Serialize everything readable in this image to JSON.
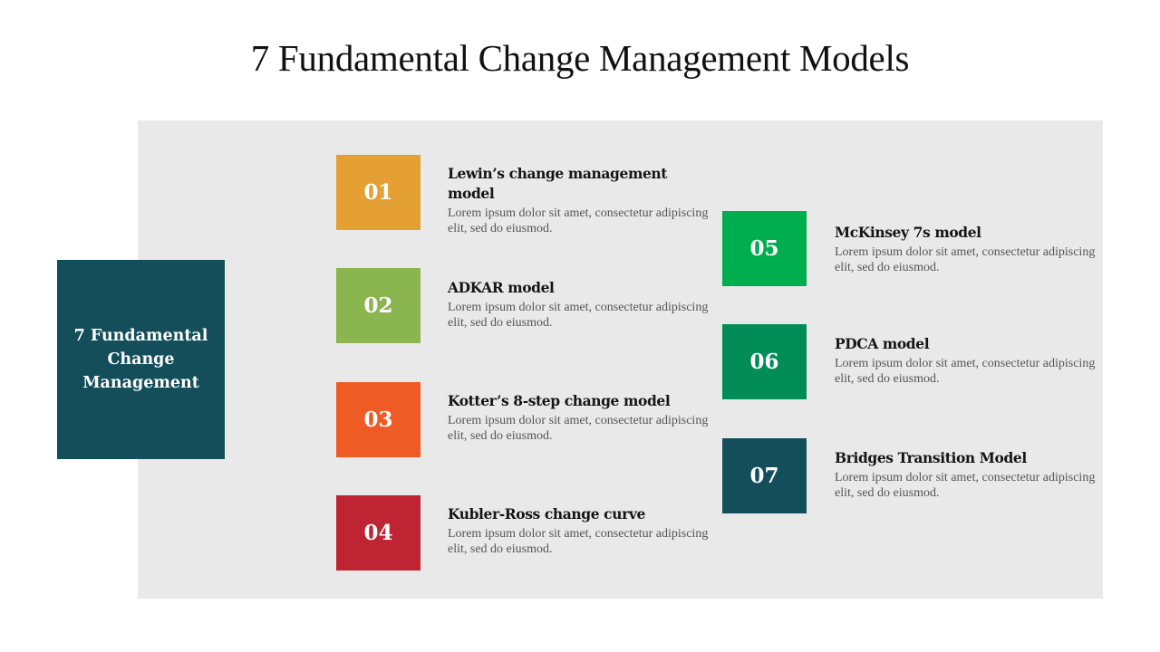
{
  "title": "7 Fundamental Change Management Models",
  "center_label": "7 Fundamental Change Management",
  "colors": {
    "background_panel": "#e9e9e9",
    "center_box": "#134e5a"
  },
  "items": [
    {
      "number": "01",
      "heading": "Lewin’s change management model",
      "description": "Lorem ipsum dolor sit amet, consectetur adipiscing elit, sed do eiusmod.",
      "color": "#e5a033"
    },
    {
      "number": "02",
      "heading": "ADKAR model",
      "description": "Lorem ipsum dolor sit amet, consectetur adipiscing elit, sed do eiusmod.",
      "color": "#8ab54f"
    },
    {
      "number": "03",
      "heading": "Kotter’s 8-step change model",
      "description": "Lorem ipsum dolor sit amet, consectetur adipiscing elit, sed do eiusmod.",
      "color": "#ef5b25"
    },
    {
      "number": "04",
      "heading": "Kubler-Ross change curve",
      "description": "Lorem ipsum dolor sit amet, consectetur adipiscing elit, sed do eiusmod.",
      "color": "#be2431"
    },
    {
      "number": "05",
      "heading": "McKinsey 7s model",
      "description": "Lorem ipsum dolor sit amet, consectetur adipiscing elit, sed do eiusmod.",
      "color": "#00ae4f"
    },
    {
      "number": "06",
      "heading": "PDCA model",
      "description": "Lorem ipsum dolor sit amet, consectetur adipiscing elit, sed do eiusmod.",
      "color": "#028d58"
    },
    {
      "number": "07",
      "heading": "Bridges Transition Model",
      "description": "Lorem ipsum dolor sit amet, consectetur adipiscing elit, sed do eiusmod.",
      "color": "#134e5a"
    }
  ]
}
